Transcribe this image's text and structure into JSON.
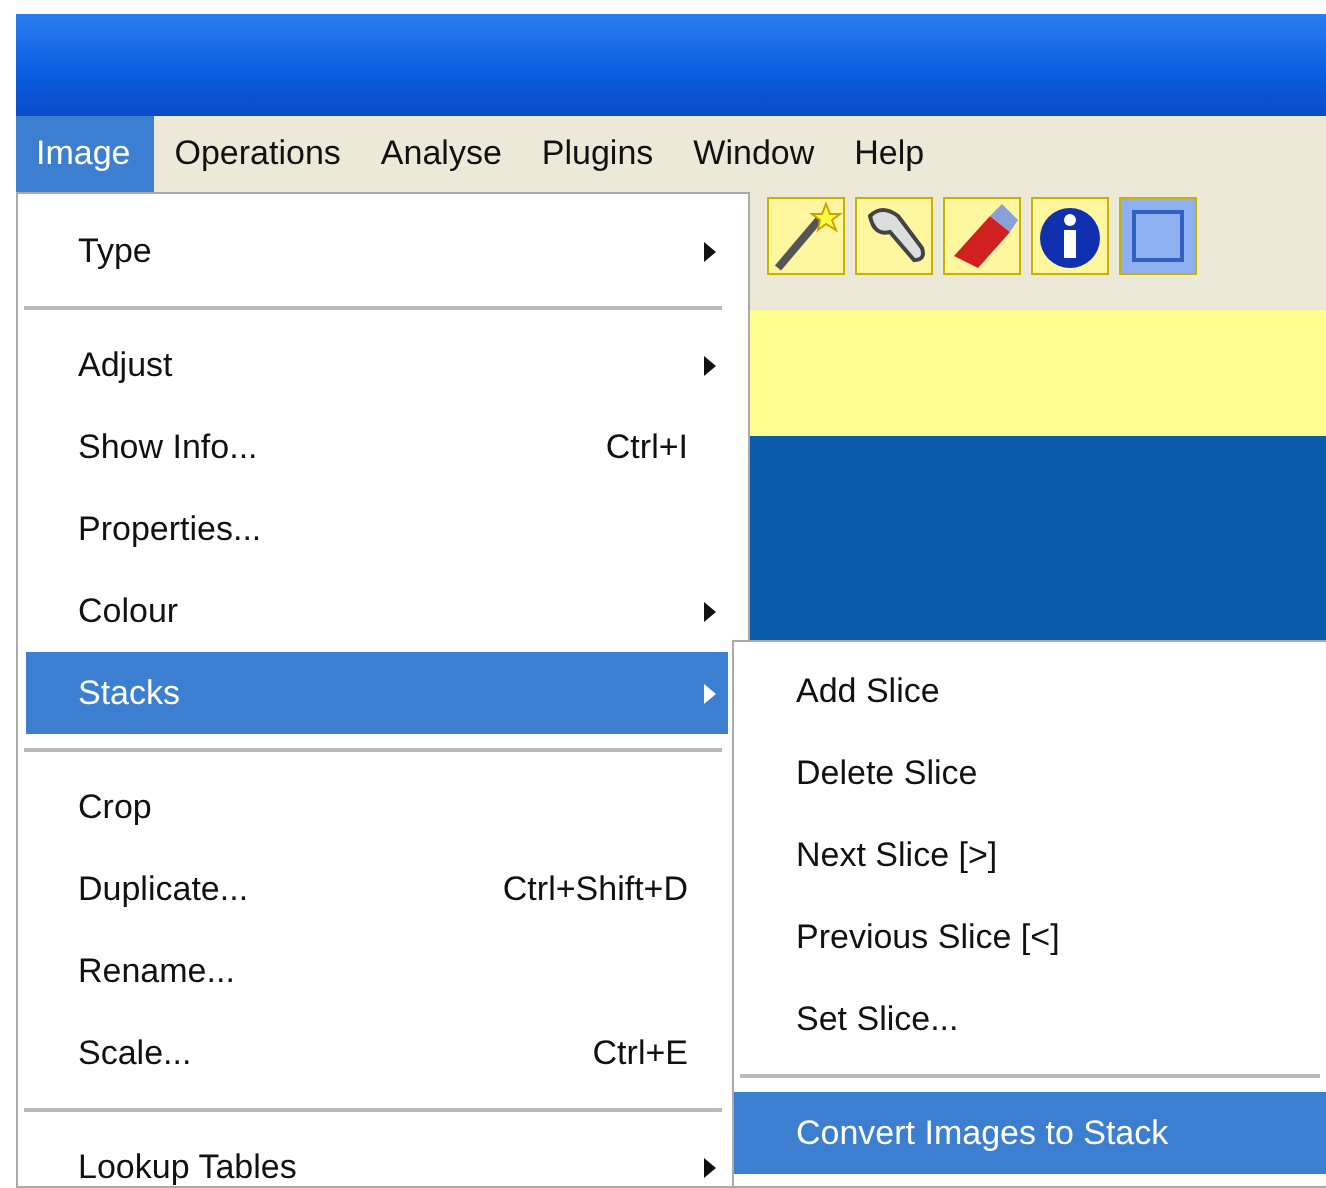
{
  "menubar": [
    {
      "label": "Image",
      "selected": true
    },
    {
      "label": "Operations",
      "selected": false
    },
    {
      "label": "Analyse",
      "selected": false
    },
    {
      "label": "Plugins",
      "selected": false
    },
    {
      "label": "Window",
      "selected": false
    },
    {
      "label": "Help",
      "selected": false
    }
  ],
  "image_menu": {
    "items": [
      {
        "kind": "item",
        "label": "Type",
        "submenu": true,
        "selected": false
      },
      {
        "kind": "separator"
      },
      {
        "kind": "item",
        "label": "Adjust",
        "submenu": true,
        "selected": false
      },
      {
        "kind": "item",
        "label": "Show Info...",
        "shortcut": "Ctrl+I",
        "selected": false
      },
      {
        "kind": "item",
        "label": "Properties...",
        "selected": false
      },
      {
        "kind": "item",
        "label": "Colour",
        "submenu": true,
        "selected": false
      },
      {
        "kind": "item",
        "label": "Stacks",
        "submenu": true,
        "selected": true
      },
      {
        "kind": "separator"
      },
      {
        "kind": "item",
        "label": "Crop",
        "selected": false
      },
      {
        "kind": "item",
        "label": "Duplicate...",
        "shortcut": "Ctrl+Shift+D",
        "selected": false
      },
      {
        "kind": "item",
        "label": "Rename...",
        "selected": false
      },
      {
        "kind": "item",
        "label": "Scale...",
        "shortcut": "Ctrl+E",
        "selected": false
      },
      {
        "kind": "separator"
      },
      {
        "kind": "item",
        "label": "Lookup Tables",
        "submenu": true,
        "selected": false
      }
    ]
  },
  "stacks_submenu": {
    "items": [
      {
        "kind": "item",
        "label": "Add Slice",
        "selected": false
      },
      {
        "kind": "item",
        "label": "Delete Slice",
        "selected": false
      },
      {
        "kind": "item",
        "label": "Next Slice [>]",
        "selected": false
      },
      {
        "kind": "item",
        "label": "Previous Slice [<]",
        "selected": false
      },
      {
        "kind": "item",
        "label": "Set Slice...",
        "selected": false
      },
      {
        "kind": "separator"
      },
      {
        "kind": "item",
        "label": "Convert Images to Stack",
        "selected": true
      }
    ]
  }
}
